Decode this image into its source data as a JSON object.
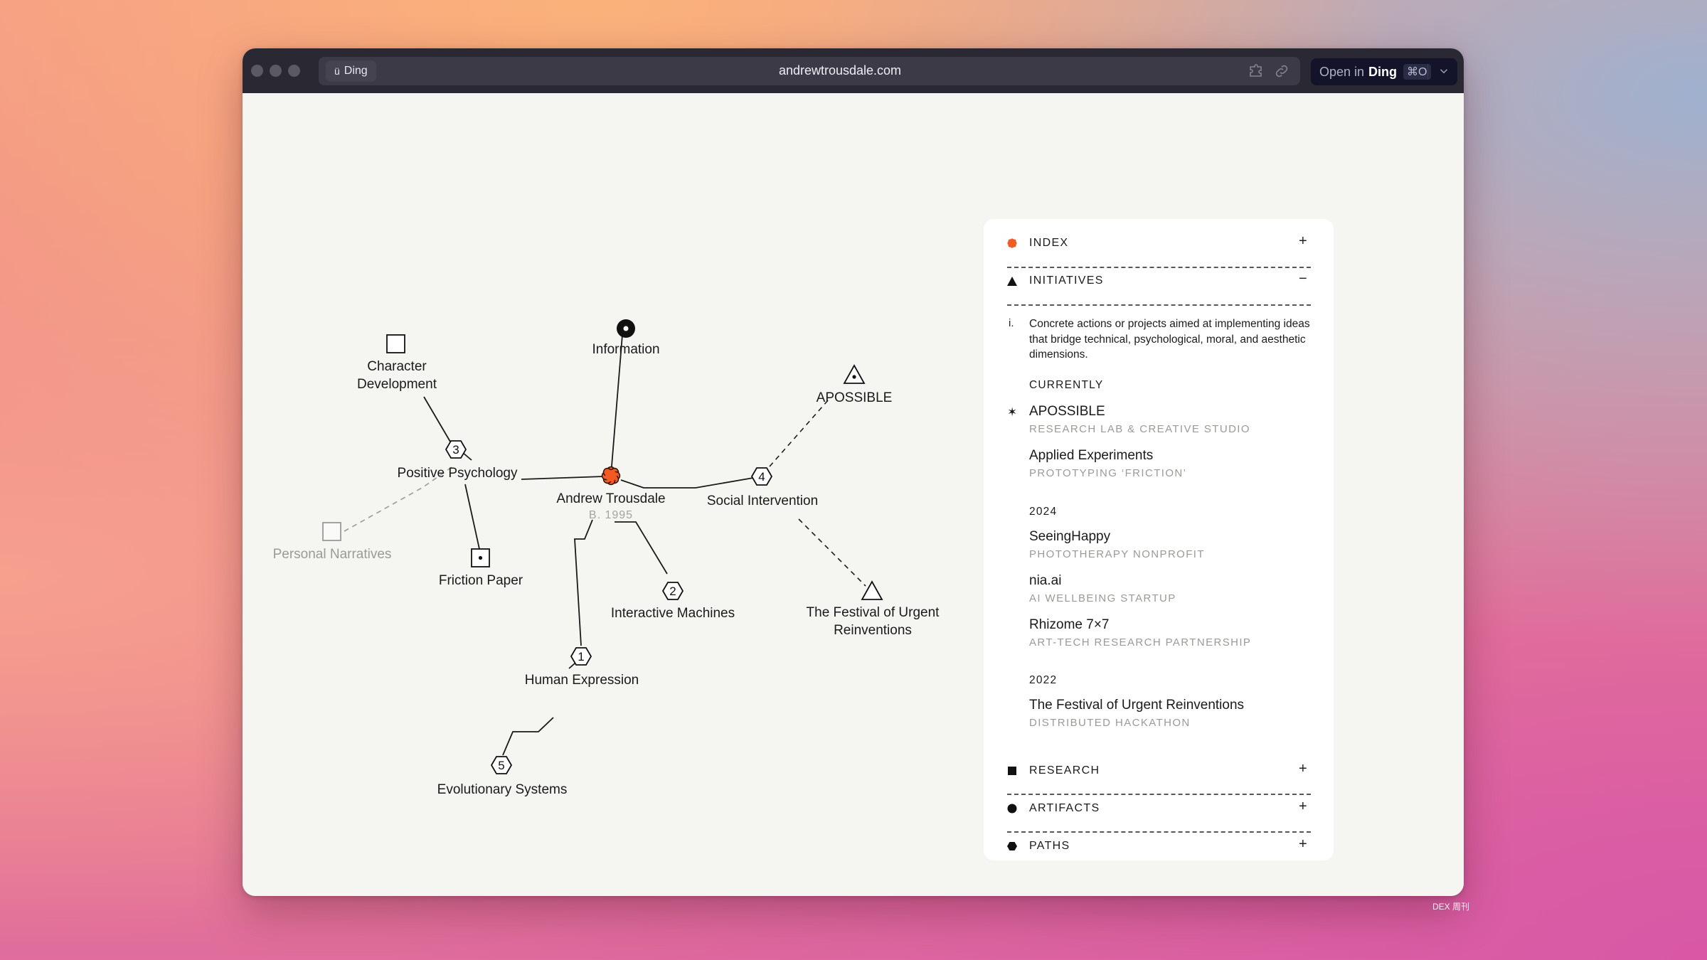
{
  "browser": {
    "app_chip": "Ding",
    "url": "andrewtrousdale.com",
    "open_in_label": "Open in",
    "open_in_app": "Ding",
    "shortcut": "⌘O",
    "icons": [
      "extension-icon",
      "link-icon",
      "chevron-down-icon"
    ]
  },
  "graph": {
    "center": {
      "label": "Andrew Trousdale",
      "sub": "B. 1995",
      "color": "#f25a24"
    },
    "nodes": [
      {
        "id": "information",
        "label": "Information",
        "shape": "filled-circle-dot"
      },
      {
        "id": "character-development",
        "label": "Character\nDevelopment",
        "shape": "square"
      },
      {
        "id": "positive-psychology",
        "label": "Positive Psychology",
        "shape": "hexagon",
        "number": "3"
      },
      {
        "id": "personal-narratives",
        "label": "Personal Narratives",
        "shape": "square",
        "muted": true
      },
      {
        "id": "friction-paper",
        "label": "Friction Paper",
        "shape": "square-dot"
      },
      {
        "id": "social-intervention",
        "label": "Social Intervention",
        "shape": "hexagon",
        "number": "4"
      },
      {
        "id": "apossible",
        "label": "APOSSIBLE",
        "shape": "triangle-dot"
      },
      {
        "id": "festival",
        "label": "The Festival of Urgent\nReinventions",
        "shape": "triangle"
      },
      {
        "id": "interactive-machines",
        "label": "Interactive Machines",
        "shape": "hexagon",
        "number": "2"
      },
      {
        "id": "human-expression",
        "label": "Human Expression",
        "shape": "hexagon",
        "number": "1"
      },
      {
        "id": "evolutionary-systems",
        "label": "Evolutionary Systems",
        "shape": "hexagon",
        "number": "5"
      }
    ]
  },
  "panel": {
    "sections": [
      {
        "id": "index",
        "label": "INDEX",
        "icon": "orange-burst-icon",
        "toggle": "+"
      },
      {
        "id": "initiatives",
        "label": "INITIATIVES",
        "icon": "triangle-icon",
        "toggle": "−"
      },
      {
        "id": "research",
        "label": "RESEARCH",
        "icon": "square-icon",
        "toggle": "+"
      },
      {
        "id": "artifacts",
        "label": "ARTIFACTS",
        "icon": "circle-icon",
        "toggle": "+"
      },
      {
        "id": "paths",
        "label": "PATHS",
        "icon": "hexagon-icon",
        "toggle": "+"
      }
    ],
    "initiatives": {
      "desc_num": "i.",
      "description": "Concrete actions or projects aimed at implementing ideas that bridge technical, psychological, moral, and aesthetic dimensions.",
      "groups": [
        {
          "label": "CURRENTLY",
          "items": [
            {
              "title": "APOSSIBLE",
              "sub": "RESEARCH LAB & CREATIVE STUDIO",
              "starred": true
            },
            {
              "title": "Applied Experiments",
              "sub": "PROTOTYPING ‘FRICTION’"
            }
          ]
        },
        {
          "label": "2024",
          "items": [
            {
              "title": "SeeingHappy",
              "sub": "PHOTOTHERAPY NONPROFIT"
            },
            {
              "title": "nia.ai",
              "sub": "AI WELLBEING STARTUP"
            },
            {
              "title": "Rhizome 7×7",
              "sub": "ART-TECH RESEARCH PARTNERSHIP"
            }
          ]
        },
        {
          "label": "2022",
          "items": [
            {
              "title": "The Festival of Urgent Reinventions",
              "sub": "DISTRIBUTED HACKATHON"
            }
          ]
        }
      ],
      "star_glyph": "✶"
    }
  },
  "watermark": "DEX 周刊"
}
